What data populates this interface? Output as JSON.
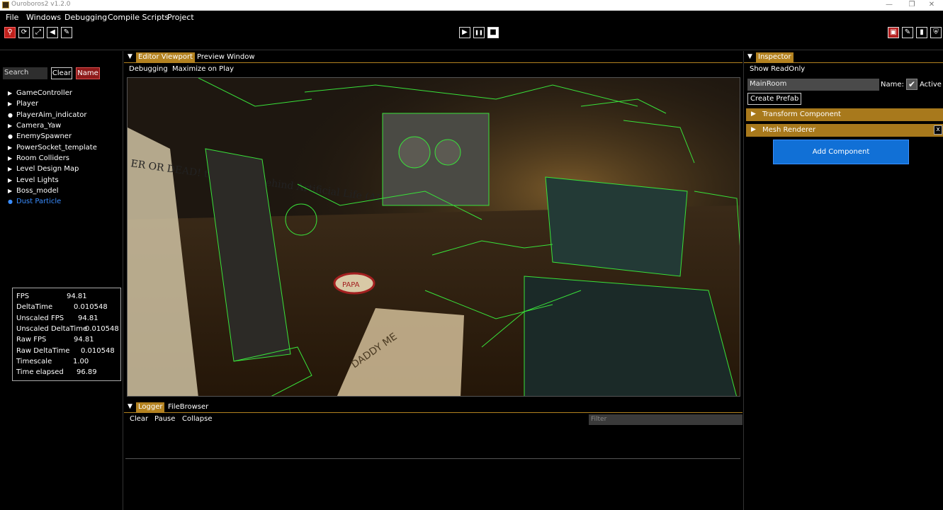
{
  "window": {
    "title": "Ouroboros2 v1.2.0",
    "minimize": "—",
    "restore": "❐",
    "close": "✕"
  },
  "menu": [
    "File",
    "Windows",
    "Debugging",
    "Compile Scripts",
    "Project"
  ],
  "toolbar": {
    "left_icons": [
      "pin-icon",
      "refresh-icon",
      "resize-icon",
      "back-icon",
      "pencil-icon"
    ],
    "play": "▶",
    "pause": "❚❚",
    "stop": "■",
    "right_icons": [
      "toolbox-icon",
      "edit-icon",
      "battery-icon",
      "shield-icon"
    ]
  },
  "hierarchy": {
    "search_placeholder": "Search",
    "clear_label": "Clear",
    "name_label": "Name",
    "items": [
      {
        "label": "GameController",
        "marker": "▶"
      },
      {
        "label": "Player",
        "marker": "▶"
      },
      {
        "label": "PlayerAim_indicator",
        "marker": "●"
      },
      {
        "label": "Camera_Yaw",
        "marker": "▶"
      },
      {
        "label": "EnemySpawner",
        "marker": "●"
      },
      {
        "label": "PowerSocket_template",
        "marker": "▶"
      },
      {
        "label": "Room Colliders",
        "marker": "▶"
      },
      {
        "label": "Level Design Map",
        "marker": "▶"
      },
      {
        "label": "Level Lights",
        "marker": "▶"
      },
      {
        "label": "Boss_model",
        "marker": "▶"
      },
      {
        "label": "Dust Particle",
        "marker": "●"
      }
    ]
  },
  "stats": [
    {
      "label": "FPS",
      "value": "94.81"
    },
    {
      "label": "DeltaTime",
      "value": "0.010548"
    },
    {
      "label": "Unscaled FPS",
      "value": "94.81"
    },
    {
      "label": "Unscaled DeltaTime",
      "value": "0.010548"
    },
    {
      "label": "Raw FPS",
      "value": "94.81"
    },
    {
      "label": "Raw DeltaTime",
      "value": "0.010548"
    },
    {
      "label": "Timescale",
      "value": "1.00"
    },
    {
      "label": "Time elapsed",
      "value": "96.89"
    }
  ],
  "editor": {
    "tabs": [
      "Editor Viewport",
      "Preview Window"
    ],
    "sub": [
      "Debugging",
      "Maximize on Play"
    ]
  },
  "scene": {
    "newspaper_text": "ER\nOR DEAD!\nthe genius behind\nArtificial Life (AL)",
    "paper_text": "DADDY  ME",
    "sign_text": "PAPA"
  },
  "inspector": {
    "tab": "Inspector",
    "show_readonly": "Show ReadOnly",
    "object_name": "MainRoom",
    "name_label": "Name:",
    "active_label": "Active",
    "checkmark": "✔",
    "create_prefab": "Create Prefab",
    "components": [
      {
        "label": "Transform Component",
        "removable": false
      },
      {
        "label": "Mesh Renderer",
        "removable": true
      }
    ],
    "remove_label": "x",
    "add_component": "Add Component"
  },
  "logger": {
    "tabs": [
      "Logger",
      "FileBrowser"
    ],
    "actions": [
      "Clear",
      "Pause",
      "Collapse"
    ],
    "filter_placeholder": "Filter"
  },
  "colors": {
    "accent": "#b38220",
    "selected": "#3a8dff",
    "add_button": "#1170d6",
    "wireframe": "#39e23a"
  }
}
